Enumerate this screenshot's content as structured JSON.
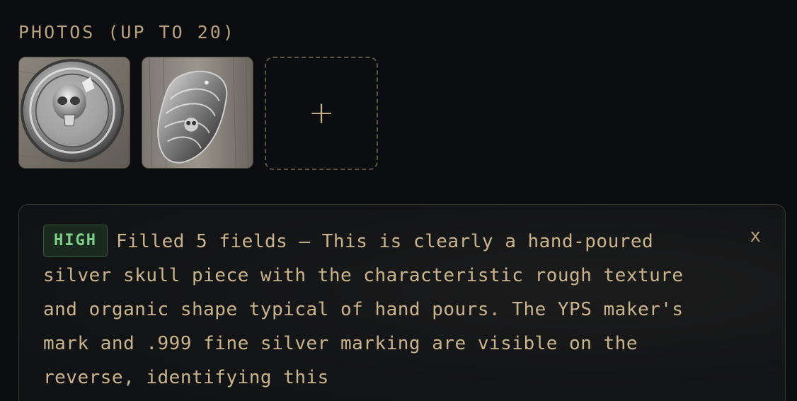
{
  "photos": {
    "label": "PHOTOS (UP TO 20)",
    "items": [
      {
        "name": "photo-1",
        "subject": "round silver skull coin"
      },
      {
        "name": "photo-2",
        "subject": "hand-poured silver skull bar"
      }
    ],
    "add_label": "+"
  },
  "ai_result": {
    "confidence": "HIGH",
    "message": "Filled 5 fields — This is clearly a hand-poured silver skull piece with the characteristic rough texture and organic shape typical of hand pours. The YPS maker's mark and .999 fine silver marking are visible on the reverse, identifying this",
    "dismiss_label": "x"
  },
  "colors": {
    "background": "#0a0c10",
    "accent_text": "#c9b48e",
    "badge_green": "#7fd08a"
  }
}
